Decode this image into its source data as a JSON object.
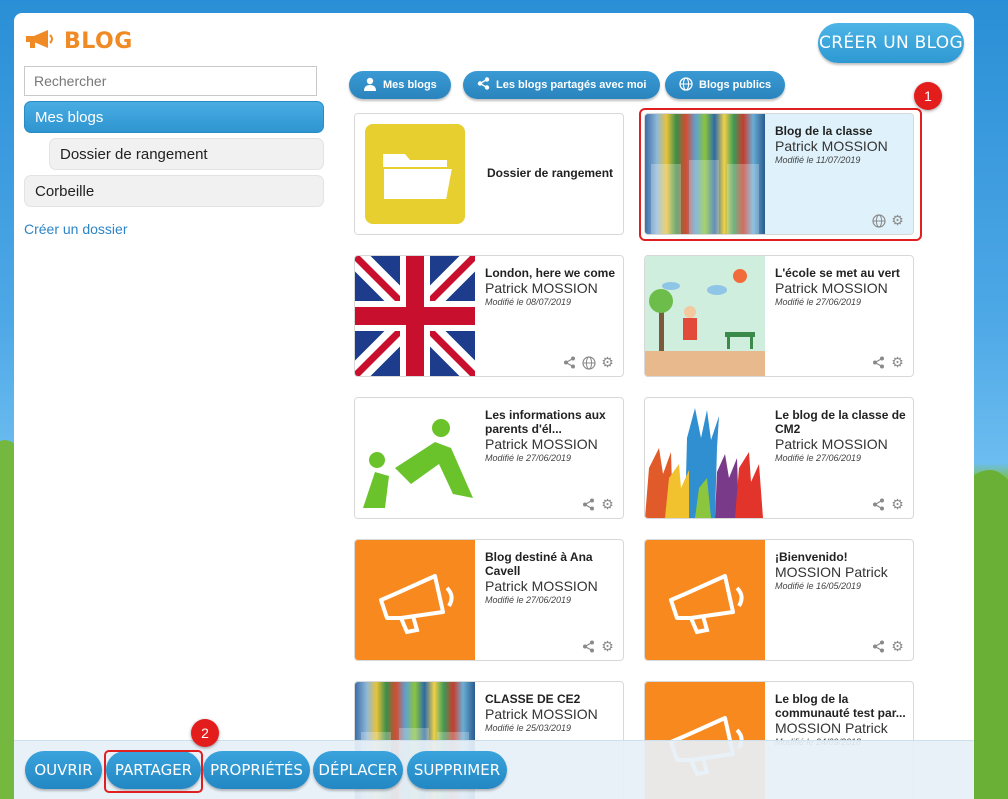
{
  "app": {
    "title": "BLOG",
    "create_button": "CRÉER UN BLOG"
  },
  "sidebar": {
    "search_placeholder": "Rechercher",
    "items": [
      {
        "label": "Mes blogs",
        "active": true
      },
      {
        "label": "Dossier de rangement",
        "active": false
      },
      {
        "label": "Corbeille",
        "active": false
      }
    ],
    "create_folder": "Créer un dossier"
  },
  "tabs": [
    {
      "label": "Mes blogs",
      "icon": "user-icon"
    },
    {
      "label": "Les blogs partagés avec moi",
      "icon": "share-icon"
    },
    {
      "label": "Blogs publics",
      "icon": "globe-icon"
    }
  ],
  "folder_card": {
    "label": "Dossier de rangement"
  },
  "blogs": [
    {
      "title": "Blog de la classe",
      "author": "Patrick MOSSION",
      "modified": "Modifié le 11/07/2019",
      "selected": true
    },
    {
      "title": "London, here we come",
      "author": "Patrick MOSSION",
      "modified": "Modifié le 08/07/2019"
    },
    {
      "title": "L'école se met au vert",
      "author": "Patrick MOSSION",
      "modified": "Modifié le 27/06/2019"
    },
    {
      "title": "Les informations aux parents d'él...",
      "author": "Patrick MOSSION",
      "modified": "Modifié le 27/06/2019"
    },
    {
      "title": "Le blog de la classe de CM2",
      "author": "Patrick MOSSION",
      "modified": "Modifié le 27/06/2019"
    },
    {
      "title": "Blog destiné à Ana Cavell",
      "author": "Patrick MOSSION",
      "modified": "Modifié le 27/06/2019"
    },
    {
      "title": "¡Bienvenido!",
      "author": "MOSSION Patrick",
      "modified": "Modifié le 16/05/2019"
    },
    {
      "title": "CLASSE DE CE2",
      "author": "Patrick MOSSION",
      "modified": "Modifié le 25/03/2019"
    },
    {
      "title": "Le blog de la communauté test par...",
      "author": "MOSSION Patrick",
      "modified": "Modifié le 24/09/2018"
    }
  ],
  "actions": [
    "OUVRIR",
    "PARTAGER",
    "PROPRIÉTÉS",
    "DÉPLACER",
    "SUPPRIMER"
  ],
  "badges": [
    "1",
    "2"
  ],
  "colors": {
    "accent": "#2d99d2",
    "brand_orange": "#f08a24",
    "highlight": "#e02020"
  }
}
